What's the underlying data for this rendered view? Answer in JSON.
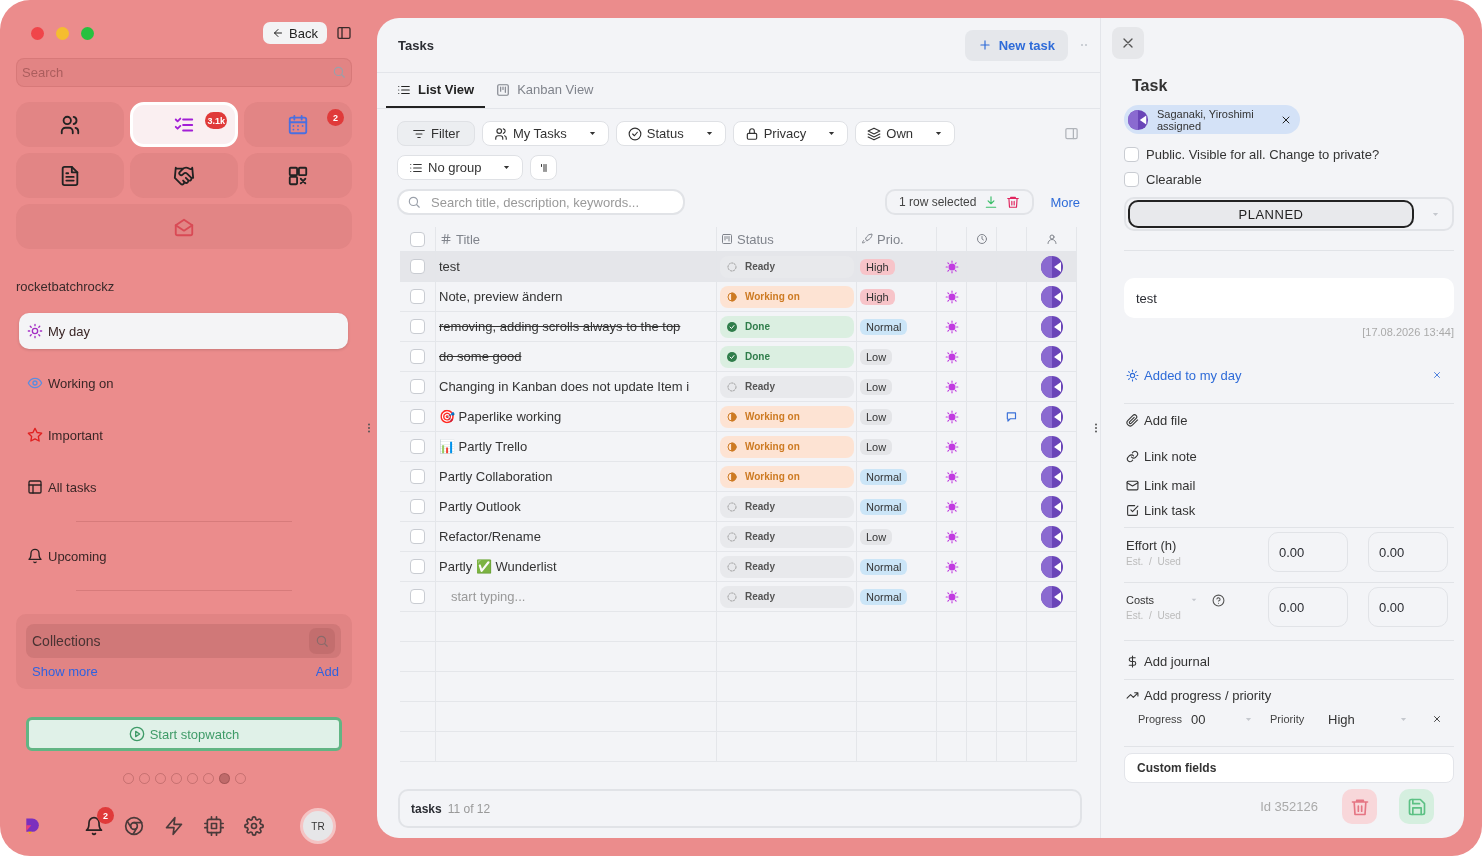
{
  "sidebar": {
    "back": "Back",
    "search": {
      "placeholder": "Search"
    },
    "apps": [
      {
        "kind": "people",
        "selected": false
      },
      {
        "kind": "tasks",
        "selected": true,
        "badge": "3.1k"
      },
      {
        "kind": "calendar",
        "selected": false,
        "badge": "2"
      },
      {
        "kind": "notes",
        "selected": false
      },
      {
        "kind": "deals",
        "selected": false
      },
      {
        "kind": "widgets",
        "selected": false
      },
      {
        "kind": "mail",
        "selected": false
      }
    ],
    "workspace": "rocketbatchrockz",
    "nav_groups": [
      {
        "items": [
          {
            "kind": "sun",
            "label": "My day",
            "selected": true
          },
          {
            "kind": "eye",
            "label": "Working on",
            "selected": false
          },
          {
            "kind": "star",
            "label": "Important",
            "selected": false
          },
          {
            "kind": "table",
            "label": "All tasks",
            "selected": false
          }
        ]
      },
      {
        "items": [
          {
            "kind": "bell",
            "label": "Upcoming",
            "selected": false
          }
        ]
      }
    ],
    "collections": {
      "title": "Collections",
      "show_more": "Show more",
      "add": "Add"
    },
    "stopwatch": "Start stopwatch",
    "pager": [
      {
        "selected": false
      },
      {
        "selected": false
      },
      {
        "selected": false
      },
      {
        "selected": false
      },
      {
        "selected": false
      },
      {
        "selected": false
      },
      {
        "selected": true
      },
      {
        "selected": false
      }
    ],
    "dock": [
      {
        "kind": "bell",
        "badge": "2"
      },
      {
        "kind": "browser"
      },
      {
        "kind": "bolt"
      },
      {
        "kind": "chip"
      },
      {
        "kind": "gear"
      }
    ],
    "user": "TR"
  },
  "tasks": {
    "title": "Tasks",
    "new_task": "New task",
    "tabs": [
      {
        "kind": "list",
        "label": "List View",
        "selected": true
      },
      {
        "kind": "kanban",
        "label": "Kanban View",
        "selected": false
      }
    ],
    "filters": [
      {
        "kind": "filter",
        "label": "Filter",
        "dropdown": false
      },
      {
        "kind": "people",
        "label": "My Tasks",
        "dropdown": true
      },
      {
        "kind": "check",
        "label": "Status",
        "dropdown": true
      },
      {
        "kind": "lock",
        "label": "Privacy",
        "dropdown": true
      },
      {
        "kind": "layers",
        "label": "Own",
        "dropdown": true
      },
      {
        "kind": "list",
        "label": "No group",
        "dropdown": true
      }
    ],
    "search": {
      "placeholder": "Search title, description, keywords..."
    },
    "selection": "1 row selected",
    "more": "More",
    "select_all": {
      "checked": false
    },
    "columns": [
      "Title",
      "Status",
      "Prio."
    ],
    "rows": [
      {
        "kind": "task",
        "title": "test",
        "done": false,
        "selected": true,
        "checked": false,
        "status": {
          "kind": "ready",
          "label": "Ready"
        },
        "priority": {
          "kind": "high",
          "label": "High"
        },
        "my_day": true,
        "comment": false
      },
      {
        "kind": "task",
        "title": "Note, preview ändern",
        "done": false,
        "selected": false,
        "checked": false,
        "status": {
          "kind": "working",
          "label": "Working on"
        },
        "priority": {
          "kind": "high",
          "label": "High"
        },
        "my_day": true,
        "comment": false
      },
      {
        "kind": "task",
        "title": "removing, adding scrolls always to the top",
        "done": true,
        "selected": false,
        "checked": false,
        "status": {
          "kind": "done",
          "label": "Done"
        },
        "priority": {
          "kind": "normal",
          "label": "Normal"
        },
        "my_day": true,
        "comment": false
      },
      {
        "kind": "task",
        "title": "do some good",
        "done": true,
        "selected": false,
        "checked": false,
        "status": {
          "kind": "done",
          "label": "Done"
        },
        "priority": {
          "kind": "low",
          "label": "Low"
        },
        "my_day": true,
        "comment": false
      },
      {
        "kind": "task",
        "title": "Changing in Kanban does not update Item i",
        "done": false,
        "selected": false,
        "checked": false,
        "status": {
          "kind": "ready",
          "label": "Ready"
        },
        "priority": {
          "kind": "low",
          "label": "Low"
        },
        "my_day": true,
        "comment": false
      },
      {
        "kind": "task",
        "title": "🎯 Paperlike working",
        "done": false,
        "selected": false,
        "checked": false,
        "status": {
          "kind": "working",
          "label": "Working on"
        },
        "priority": {
          "kind": "low",
          "label": "Low"
        },
        "my_day": true,
        "comment": true
      },
      {
        "kind": "task",
        "title": "📊 Partly Trello",
        "done": false,
        "selected": false,
        "checked": false,
        "status": {
          "kind": "working",
          "label": "Working on"
        },
        "priority": {
          "kind": "low",
          "label": "Low"
        },
        "my_day": true,
        "comment": false
      },
      {
        "kind": "task",
        "title": "Partly Collaboration",
        "done": false,
        "selected": false,
        "checked": false,
        "status": {
          "kind": "working",
          "label": "Working on"
        },
        "priority": {
          "kind": "normal",
          "label": "Normal"
        },
        "my_day": true,
        "comment": false
      },
      {
        "kind": "task",
        "title": "Partly Outlook",
        "done": false,
        "selected": false,
        "checked": false,
        "status": {
          "kind": "ready",
          "label": "Ready"
        },
        "priority": {
          "kind": "normal",
          "label": "Normal"
        },
        "my_day": true,
        "comment": false
      },
      {
        "kind": "task",
        "title": "Refactor/Rename",
        "done": false,
        "selected": false,
        "checked": false,
        "status": {
          "kind": "ready",
          "label": "Ready"
        },
        "priority": {
          "kind": "low",
          "label": "Low"
        },
        "my_day": true,
        "comment": false
      },
      {
        "kind": "task",
        "title": "Partly ✅ Wunderlist",
        "done": false,
        "selected": false,
        "checked": false,
        "status": {
          "kind": "ready",
          "label": "Ready"
        },
        "priority": {
          "kind": "normal",
          "label": "Normal"
        },
        "my_day": true,
        "comment": false
      },
      {
        "kind": "new",
        "placeholder": "start typing...",
        "selected": false,
        "checked": false,
        "status": {
          "kind": "ready",
          "label": "Ready"
        },
        "priority": {
          "kind": "normal",
          "label": "Normal"
        },
        "my_day": true,
        "comment": false
      }
    ],
    "footer": {
      "label": "tasks",
      "count": "11 of 12"
    }
  },
  "detail": {
    "heading": "Task",
    "assignee": {
      "name": "Saganaki, Yiroshimi",
      "role": "assigned"
    },
    "options": [
      {
        "label": "Public. Visible for all. Change to private?",
        "checked": false
      },
      {
        "label": "Clearable",
        "checked": false
      }
    ],
    "state": "PLANNED",
    "title_value": "test",
    "timestamp": "[17.08.2026 13:44]",
    "my_day": {
      "label": "Added to my day",
      "on": true
    },
    "links": [
      {
        "kind": "file",
        "label": "Add file"
      },
      {
        "kind": "note",
        "label": "Link note"
      },
      {
        "kind": "mail",
        "label": "Link mail"
      },
      {
        "kind": "task",
        "label": "Link task"
      }
    ],
    "measures": [
      {
        "kind": "effort",
        "label": "Effort (h)",
        "sub": "Est. / Used",
        "values": [
          "0.00",
          "0.00"
        ]
      },
      {
        "kind": "costs",
        "label": "Costs",
        "sub": "Est. / Used",
        "values": [
          "0.00",
          "0.00"
        ]
      }
    ],
    "journal": "Add journal",
    "progress": {
      "heading": "Add progress / priority",
      "progress_label": "Progress",
      "progress_value": "00",
      "priority_label": "Priority",
      "priority_value": "High"
    },
    "custom_fields": "Custom fields",
    "id": "Id 352126"
  }
}
